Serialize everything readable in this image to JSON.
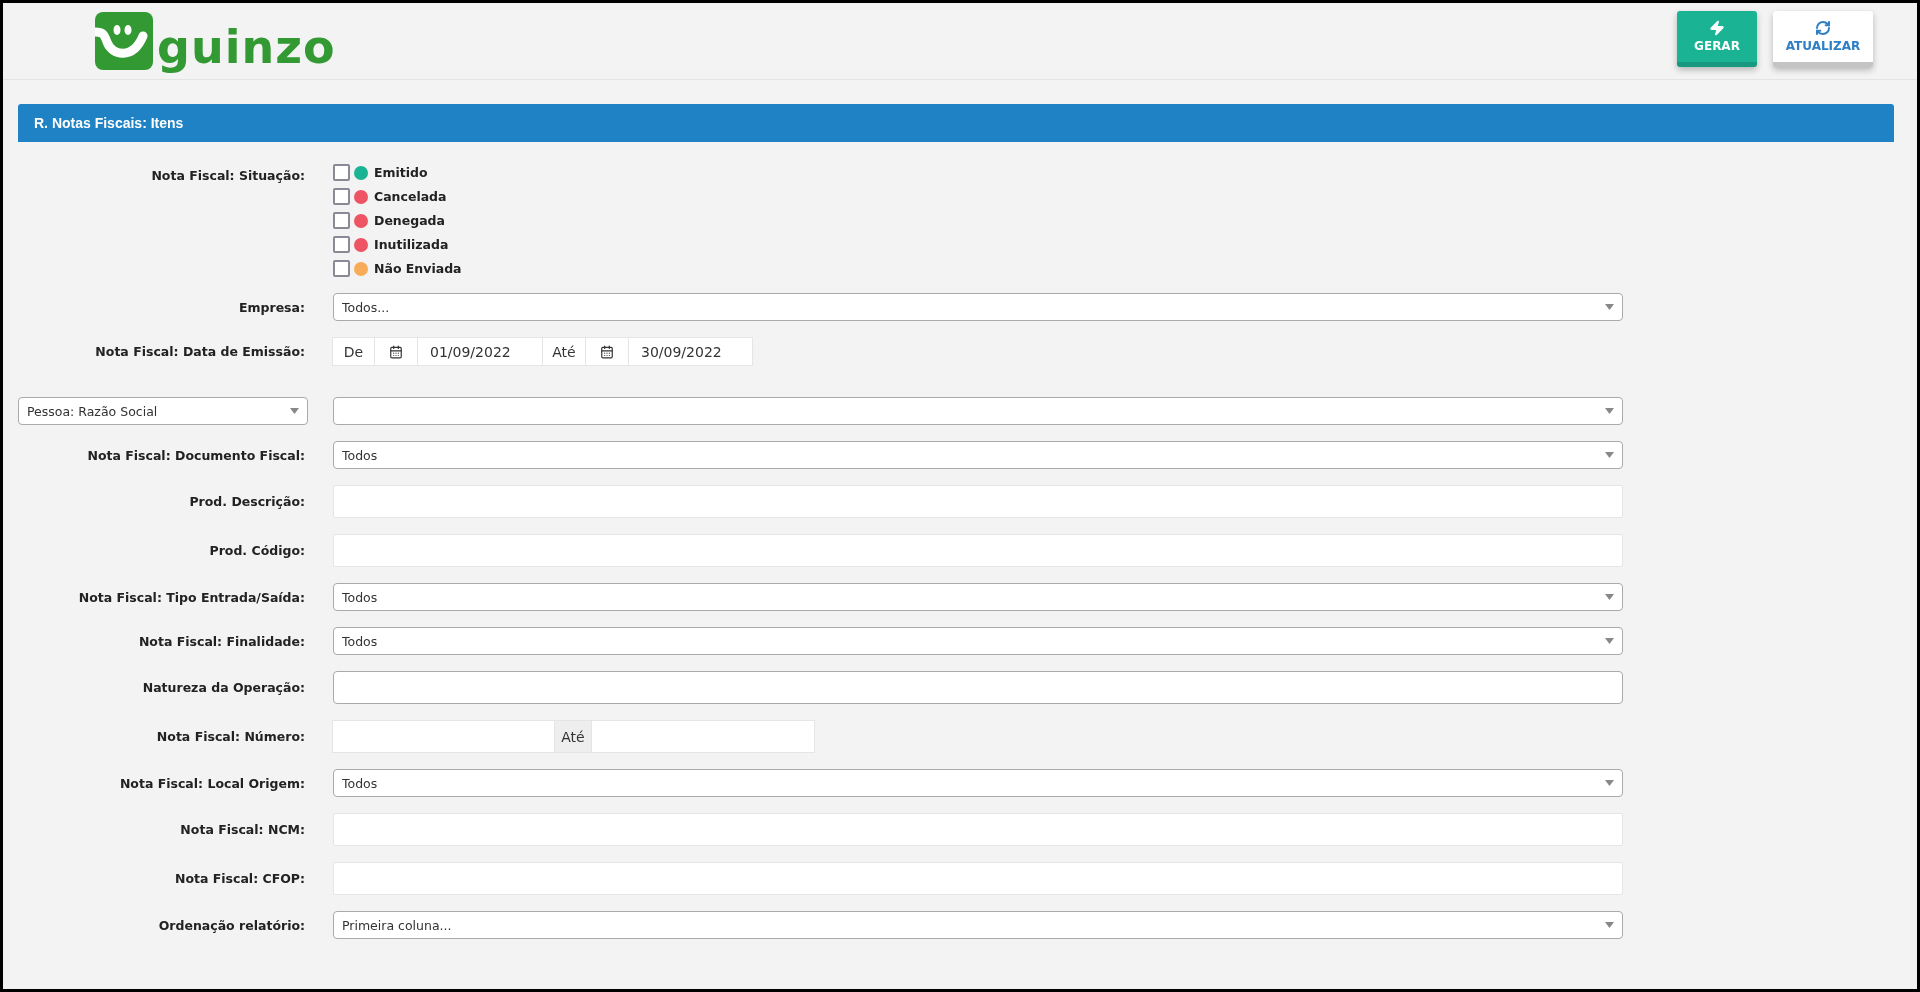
{
  "header": {
    "logo_text": "guinzo",
    "buttons": [
      {
        "label": "GERAR",
        "kind": "primary"
      },
      {
        "label": "ATUALIZAR",
        "kind": "default"
      }
    ]
  },
  "panel": {
    "title": "R. Notas Fiscais: Itens"
  },
  "form": {
    "rows": [
      {
        "kind": "checklist",
        "label": "Nota Fiscal: Situação:",
        "options": [
          {
            "label": "Emitido",
            "checked": false,
            "color": "#1ab394"
          },
          {
            "label": "Cancelada",
            "checked": false,
            "color": "#ed5565"
          },
          {
            "label": "Denegada",
            "checked": false,
            "color": "#ed5565"
          },
          {
            "label": "Inutilizada",
            "checked": false,
            "color": "#ed5565"
          },
          {
            "label": "Não Enviada",
            "checked": false,
            "color": "#f8ac59"
          }
        ]
      },
      {
        "kind": "select",
        "label": "Empresa:",
        "value": "Todos..."
      },
      {
        "kind": "date_range",
        "label": "Nota Fiscal: Data de Emissão:",
        "from_label": "De",
        "from": "01/09/2022",
        "to_label": "Até",
        "to": "30/09/2022"
      },
      {
        "kind": "select_by",
        "field_select": "Pessoa: Razão Social"
      },
      {
        "kind": "select",
        "label": "Nota Fiscal: Documento Fiscal:",
        "value": "Todos"
      },
      {
        "kind": "text",
        "label": "Prod. Descrição:"
      },
      {
        "kind": "text",
        "label": "Prod. Código:"
      },
      {
        "kind": "select",
        "label": "Nota Fiscal: Tipo Entrada/Saída:",
        "value": "Todos"
      },
      {
        "kind": "select",
        "label": "Nota Fiscal: Finalidade:",
        "value": "Todos"
      },
      {
        "kind": "text_bordered",
        "label": "Natureza da Operação:"
      },
      {
        "kind": "number_range",
        "label": "Nota Fiscal: Número:",
        "separator": "Até"
      },
      {
        "kind": "select",
        "label": "Nota Fiscal: Local Origem:",
        "value": "Todos"
      },
      {
        "kind": "text",
        "label": "Nota Fiscal: NCM:"
      },
      {
        "kind": "text",
        "label": "Nota Fiscal: CFOP:"
      },
      {
        "kind": "select",
        "label": "Ordenação relatório:",
        "value": "Primeira coluna..."
      }
    ]
  }
}
